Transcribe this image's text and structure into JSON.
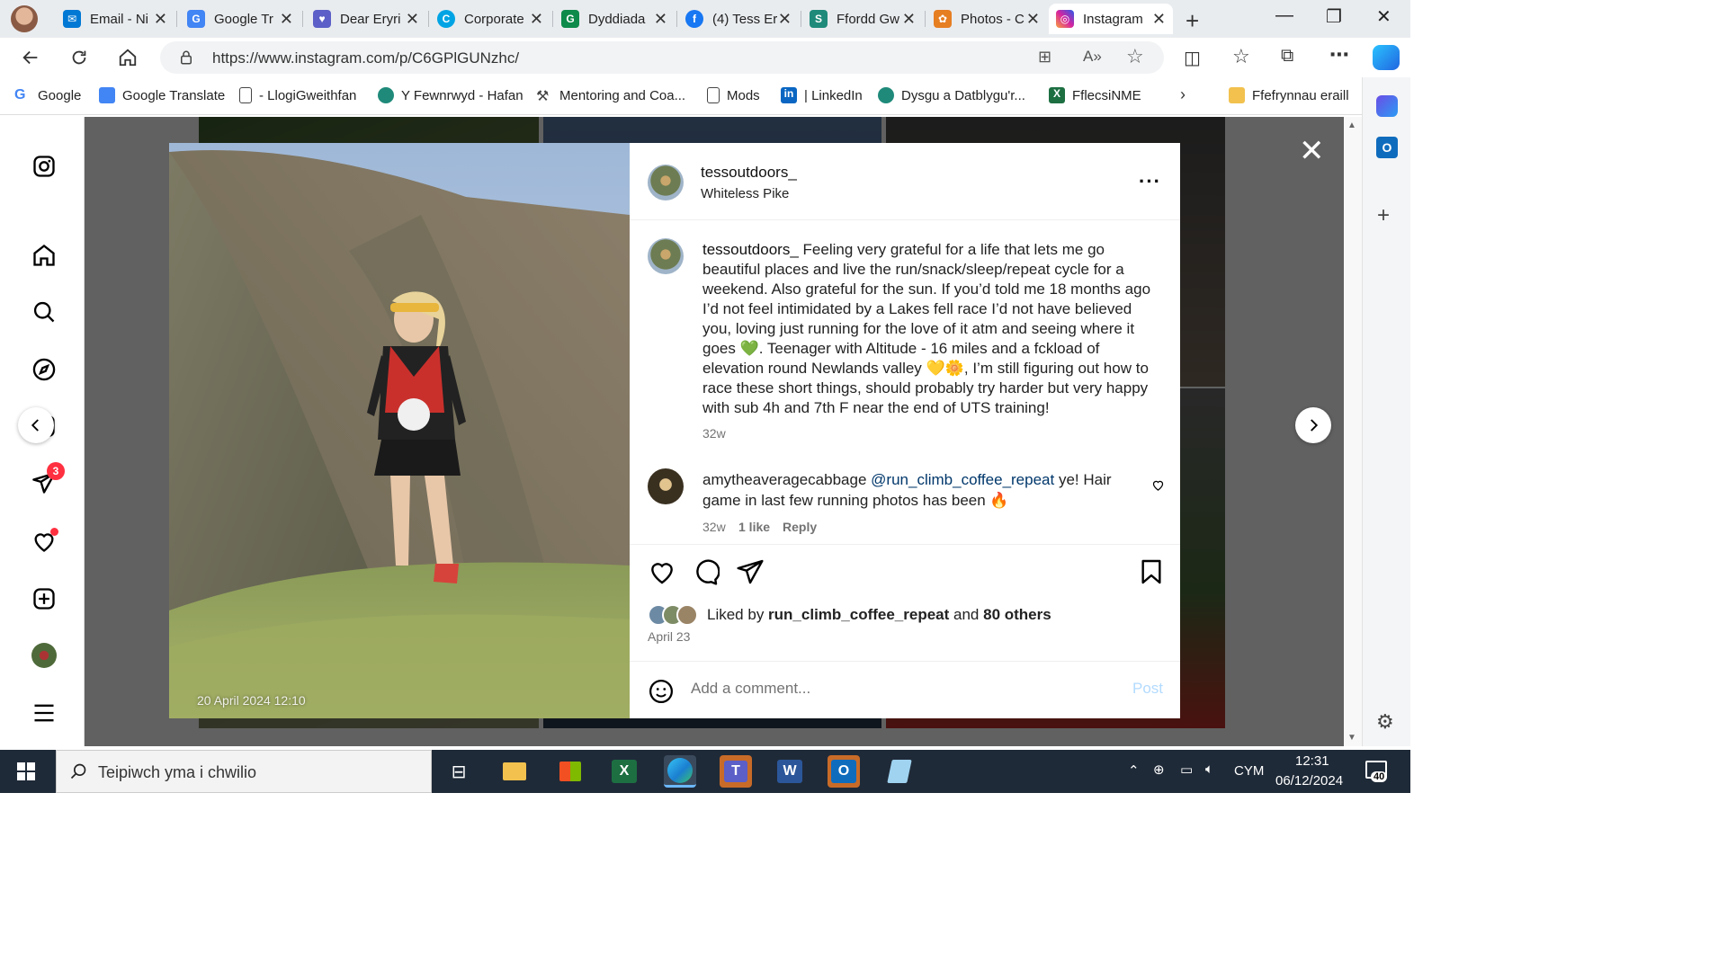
{
  "browser": {
    "tabs": [
      {
        "title": "Email - Ni",
        "color": "#0078d4",
        "glyph": "✉"
      },
      {
        "title": "Google Tr",
        "color": "#4285f4",
        "glyph": "G"
      },
      {
        "title": "Dear Eryri",
        "color": "#5b5fc7",
        "glyph": "♥"
      },
      {
        "title": "Corporate",
        "color": "#00a4e4",
        "glyph": "C"
      },
      {
        "title": "Dyddiada",
        "color": "#0e8a4a",
        "glyph": "G"
      },
      {
        "title": "(4) Tess Er",
        "color": "#1877f2",
        "glyph": "f"
      },
      {
        "title": "Ffordd Gw",
        "color": "#1f8a7a",
        "glyph": "S"
      },
      {
        "title": "Photos - C",
        "color": "#e67e22",
        "glyph": "✿"
      },
      {
        "title": "Instagram",
        "color": "#d6249f",
        "glyph": "◎"
      }
    ],
    "url": "https://www.instagram.com/p/C6GPlGUNzhc/",
    "bookmarks": [
      {
        "label": "Google",
        "color": "#4285f4"
      },
      {
        "label": "Google Translate",
        "color": "#4285f4"
      },
      {
        "label": "- LlogiGweithfan",
        "color": "#ffffff"
      },
      {
        "label": "Y Fewnrwyd - Hafan",
        "color": "#1f8a7a"
      },
      {
        "label": "Mentoring and Coa...",
        "color": "#ffffff"
      },
      {
        "label": "Mods",
        "color": "#ffffff"
      },
      {
        "label": "| LinkedIn",
        "color": "#0a66c2"
      },
      {
        "label": "Dysgu a Datblygu'r...",
        "color": "#1f8a7a"
      },
      {
        "label": "FflecsiNME",
        "color": "#1d6f42"
      }
    ],
    "other_favourites": "Ffefrynnau eraill"
  },
  "post": {
    "author": "tessoutdoors_",
    "location": "Whiteless Pike",
    "caption_author": "tessoutdoors_",
    "caption": "Feeling very grateful for a life that lets me go beautiful places and live the run/snack/sleep/repeat cycle for a weekend. Also grateful for the sun. If you’d told me 18 months ago I’d not feel intimidated by a Lakes fell race I’d not have believed you, loving just running for the love of it atm and seeing where it goes 💚. Teenager with Altitude - 16 miles and a fckload of elevation round Newlands valley 💛🌼, I’m still figuring out how to race these short things, should probably try harder but very happy with sub 4h and 7th F near the end of UTS training!",
    "caption_age": "32w",
    "photo_stamp": "20 April 2024 12:10",
    "comment": {
      "author": "amytheaveragecabbage",
      "mention": "@run_climb_coffee_repeat",
      "text": " ye! Hair game in last few running photos has been 🔥",
      "age": "32w",
      "likes": "1 like",
      "reply": "Reply"
    },
    "liked_prefix": "Liked by ",
    "liked_user": "run_climb_coffee_repeat",
    "liked_and": " and ",
    "liked_others": "80 others",
    "date": "April 23",
    "add_comment_placeholder": "Add a comment...",
    "post_button": "Post"
  },
  "sidebar": {
    "notification_badge": "3"
  },
  "taskbar": {
    "search_placeholder": "Teipiwch yma i chwilio",
    "language": "CYM",
    "time": "12:31",
    "date": "06/12/2024",
    "notification_count": "40"
  }
}
